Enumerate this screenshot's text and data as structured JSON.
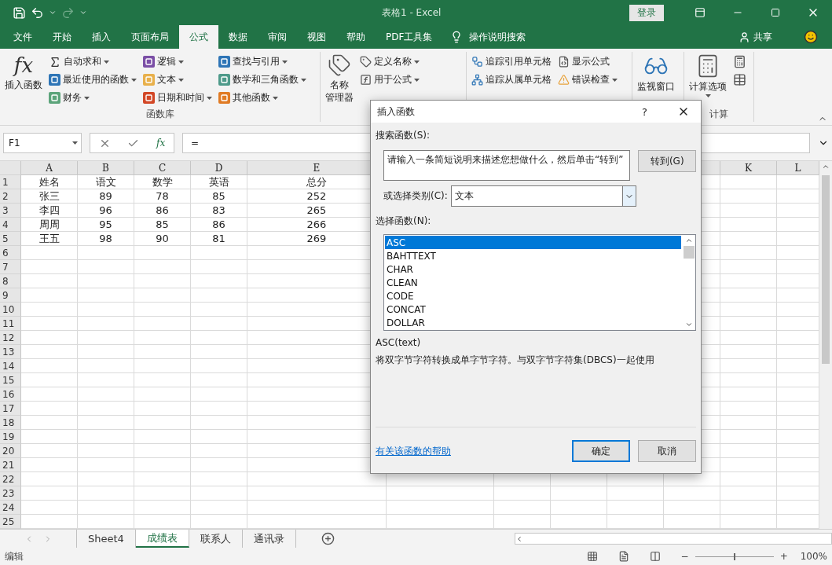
{
  "title_bar": {
    "title": "表格1  -  Excel",
    "sign_in": "登录"
  },
  "ribbon_tabs": [
    {
      "label": "文件",
      "selected": false
    },
    {
      "label": "开始",
      "selected": false
    },
    {
      "label": "插入",
      "selected": false
    },
    {
      "label": "页面布局",
      "selected": false
    },
    {
      "label": "公式",
      "selected": true
    },
    {
      "label": "数据",
      "selected": false
    },
    {
      "label": "审阅",
      "selected": false
    },
    {
      "label": "视图",
      "selected": false
    },
    {
      "label": "帮助",
      "selected": false
    },
    {
      "label": "PDF工具集",
      "selected": false
    }
  ],
  "tell_me": "操作说明搜索",
  "share": "共享",
  "ribbon_groups": [
    {
      "label": "函数库",
      "large": [
        {
          "lines": [
            "插入函数"
          ],
          "glyph": "fx",
          "kind": "fx",
          "dropdown": false
        }
      ],
      "columns": [
        [
          {
            "label": "自动求和",
            "kind": "sigma",
            "dropdown": true
          },
          {
            "label": "最近使用的函数",
            "kind": "star",
            "dropdown": true
          },
          {
            "label": "财务",
            "kind": "coins",
            "dropdown": true
          }
        ],
        [
          {
            "label": "逻辑",
            "kind": "logic",
            "dropdown": true
          },
          {
            "label": "文本",
            "kind": "text",
            "dropdown": true
          },
          {
            "label": "日期和时间",
            "kind": "clock",
            "dropdown": true
          }
        ],
        [
          {
            "label": "查找与引用",
            "kind": "lookup",
            "dropdown": true
          },
          {
            "label": "数学和三角函数",
            "kind": "math",
            "dropdown": true
          },
          {
            "label": "其他函数",
            "kind": "more",
            "dropdown": true
          }
        ]
      ]
    },
    {
      "large": [
        {
          "lines": [
            "名称",
            "管理器"
          ],
          "kind": "tags",
          "dropdown": false
        }
      ],
      "columns": [
        [
          {
            "label": "定义名称",
            "kind": "tag",
            "dropdown": true
          },
          {
            "label": "用于公式",
            "kind": "formula",
            "dropdown": true
          }
        ]
      ]
    },
    {
      "columns": [
        [
          {
            "label": "追踪引用单元格",
            "kind": "precedents",
            "dropdown": false
          },
          {
            "label": "追踪从属单元格",
            "kind": "dependents",
            "dropdown": false
          }
        ],
        [
          {
            "label": "显示公式",
            "kind": "showformula",
            "dropdown": false
          },
          {
            "label": "错误检查",
            "kind": "error",
            "dropdown": true
          }
        ]
      ]
    },
    {
      "large": [
        {
          "lines": [
            "监视窗口"
          ],
          "kind": "glasses",
          "dropdown": false
        }
      ]
    },
    {
      "label": "计算",
      "large": [
        {
          "lines": [
            "计算选项"
          ],
          "kind": "calculator",
          "dropdown": true
        }
      ],
      "columns": [
        [
          {
            "kind": "calcsmall",
            "dropdown": false
          },
          {
            "kind": "sheetcalc",
            "dropdown": false
          }
        ]
      ]
    }
  ],
  "formula_bar": {
    "name_box": "F1",
    "fx": "fx",
    "value": "="
  },
  "columns": [
    {
      "label": "A"
    },
    {
      "label": "B"
    },
    {
      "label": "C"
    },
    {
      "label": "D"
    },
    {
      "label": "E"
    },
    {
      "label": "K"
    },
    {
      "label": "L"
    }
  ],
  "rows": [
    {
      "number": "1",
      "cells": [
        "姓名",
        "语文",
        "数学",
        "英语",
        "总分"
      ]
    },
    {
      "number": "2",
      "cells": [
        "张三",
        "89",
        "78",
        "85",
        "252"
      ]
    },
    {
      "number": "3",
      "cells": [
        "李四",
        "96",
        "86",
        "83",
        "265"
      ]
    },
    {
      "number": "4",
      "cells": [
        "周周",
        "95",
        "85",
        "86",
        "266"
      ]
    },
    {
      "number": "5",
      "cells": [
        "王五",
        "98",
        "90",
        "81",
        "269"
      ]
    },
    {
      "number": "6"
    },
    {
      "number": "7"
    },
    {
      "number": "8"
    },
    {
      "number": "9"
    },
    {
      "number": "10"
    },
    {
      "number": "11"
    },
    {
      "number": "12"
    },
    {
      "number": "13"
    },
    {
      "number": "14"
    },
    {
      "number": "15"
    },
    {
      "number": "16"
    },
    {
      "number": "17"
    },
    {
      "number": "18"
    },
    {
      "number": "19"
    },
    {
      "number": "20"
    },
    {
      "number": "21"
    },
    {
      "number": "22"
    },
    {
      "number": "23"
    },
    {
      "number": "24"
    },
    {
      "number": "25"
    }
  ],
  "sheet_tabs": [
    {
      "label": "Sheet4",
      "selected": false
    },
    {
      "label": "成绩表",
      "selected": true
    },
    {
      "label": "联系人",
      "selected": false
    },
    {
      "label": "通讯录",
      "selected": false
    }
  ],
  "status_bar": {
    "mode": "编辑",
    "zoom_minus": "−",
    "zoom_plus": "+",
    "zoom": {
      "level": 0.5
    },
    "zoom_reading": "100%"
  },
  "dialog": {
    "title": "插入函数",
    "help": "?",
    "search_label": "搜索函数(S):",
    "search_value": "请输入一条简短说明来描述您想做什么，然后单击“转到”",
    "go_button": "转到(G)",
    "category_label": "或选择类别(C):",
    "category_value": "文本",
    "list_label": "选择函数(N):",
    "functions": [
      {
        "name": "ASC",
        "selected": true
      },
      {
        "name": "BAHTTEXT",
        "selected": false
      },
      {
        "name": "CHAR",
        "selected": false
      },
      {
        "name": "CLEAN",
        "selected": false
      },
      {
        "name": "CODE",
        "selected": false
      },
      {
        "name": "CONCAT",
        "selected": false
      },
      {
        "name": "DOLLAR",
        "selected": false
      }
    ],
    "signature": "ASC(text)",
    "description": "将双字节字符转换成单字节字符。与双字节字符集(DBCS)一起使用",
    "help_link": "有关该函数的帮助",
    "ok": "确定",
    "cancel": "取消"
  }
}
